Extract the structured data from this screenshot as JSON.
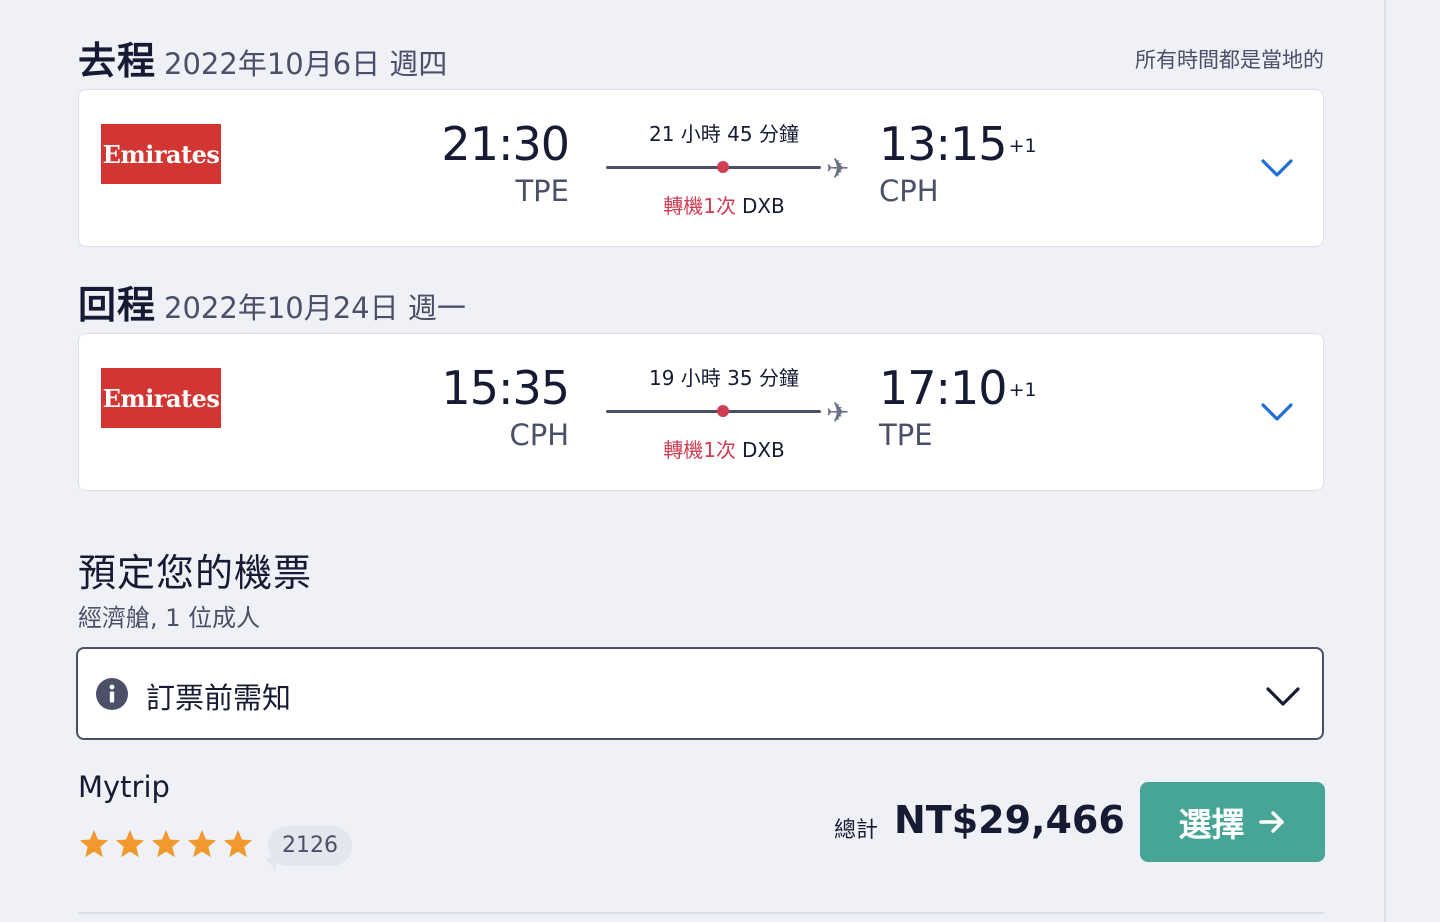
{
  "outbound": {
    "label": "去程",
    "date": "2022年10月6日 週四",
    "timezone_note": "所有時間都是當地的",
    "airline": "Emirates",
    "depart_time": "21:30",
    "depart_code": "TPE",
    "duration": "21 小時 45 分鐘",
    "stops": "轉機1次",
    "stop_airport": "DXB",
    "arrive_time": "13:15",
    "arrive_day_offset": "+1",
    "arrive_code": "CPH",
    "expand_icon": "chevron-down-icon"
  },
  "return": {
    "label": "回程",
    "date": "2022年10月24日 週一",
    "airline": "Emirates",
    "depart_time": "15:35",
    "depart_code": "CPH",
    "duration": "19 小時 35 分鐘",
    "stops": "轉機1次",
    "stop_airport": "DXB",
    "arrive_time": "17:10",
    "arrive_day_offset": "+1",
    "arrive_code": "TPE",
    "expand_icon": "chevron-down-icon"
  },
  "booking": {
    "title": "預定您的機票",
    "subtitle": "經濟艙, 1 位成人",
    "notice_label": "訂票前需知",
    "notice_icon": "info-icon"
  },
  "offer": {
    "provider": "Mytrip",
    "rating_stars": 5,
    "review_count": "2126",
    "total_label": "總計",
    "total_price": "NT$29,466",
    "select_label": "選擇"
  },
  "colors": {
    "background": "#eff1f7",
    "airline_red": "#d13632",
    "stop_red": "#cf3d52",
    "chevron_blue": "#1f6fd6",
    "star_orange": "#f29a2e",
    "button_green": "#46a595",
    "text_dark": "#161b33"
  }
}
